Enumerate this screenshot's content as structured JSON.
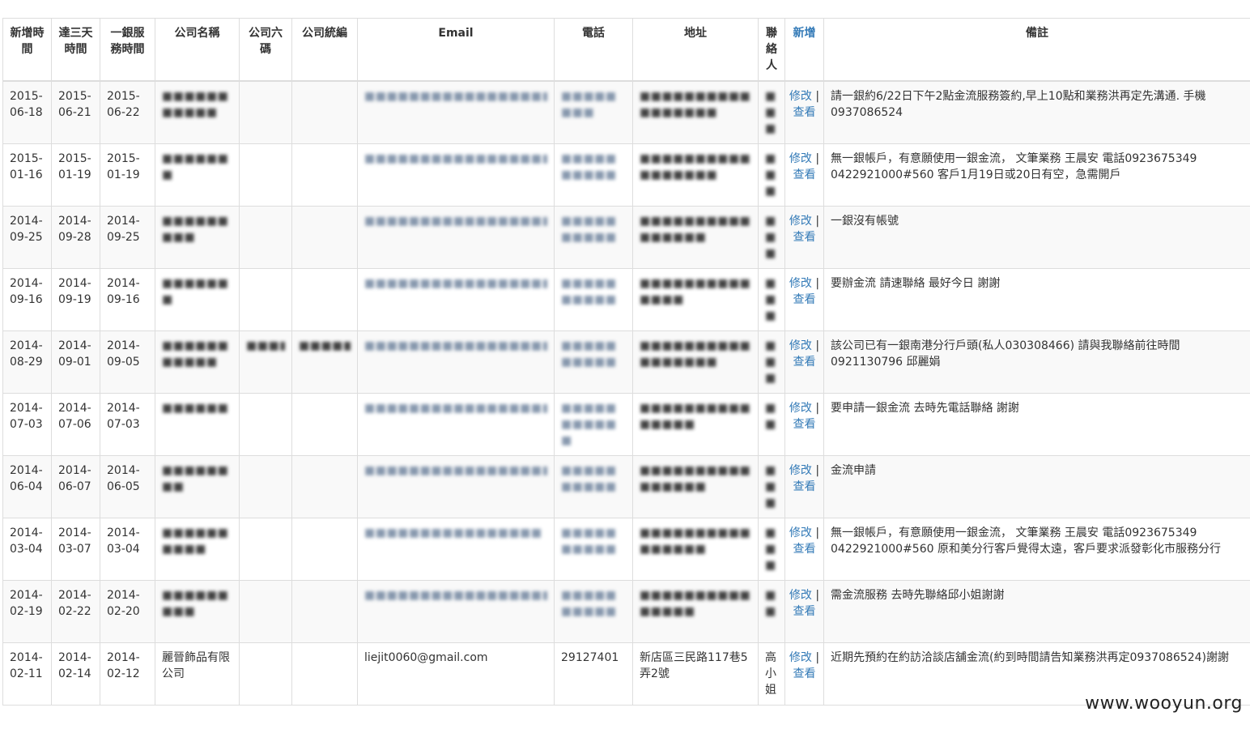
{
  "headers": {
    "created": "新增時間",
    "reach3days": "達三天時間",
    "bank_service": "一銀服務時間",
    "company_name": "公司名稱",
    "company_6code": "公司六碼",
    "tax_id": "公司統編",
    "email": "Email",
    "phone": "電話",
    "address": "地址",
    "contact": "聯絡人",
    "add_link": "新增",
    "notes": "備註"
  },
  "actions": {
    "edit": "修改",
    "sep": " | ",
    "view": "查看"
  },
  "rows": [
    {
      "created": "2015-06-18",
      "reach3": "2015-06-21",
      "service": "2015-06-22",
      "name": "■■■■■■■■■■■",
      "code6": "",
      "taxid": "",
      "email": "■■■■■■■■■■■■■■■■■■■■■■■■■■■",
      "phone": "■■■■■■■■",
      "address": "■■■■■■■■■■■■■■■■■",
      "contact": "■■■",
      "notes": "請一銀約6/22日下午2點金流服務簽約,早上10點和業務洪再定先溝通. 手機0937086524"
    },
    {
      "created": "2015-01-16",
      "reach3": "2015-01-19",
      "service": "2015-01-19",
      "name": "■■■■■■■",
      "code6": "",
      "taxid": "",
      "email": "■■■■■■■■■■■■■■■■■■■■",
      "phone": "■■■■■■■■■■",
      "address": "■■■■■■■■■■■■■■■■■",
      "contact": "■■■",
      "notes": "無一銀帳戶，有意願使用一銀金流， 文筆業務 王晨安 電話0923675349 0422921000#560 客戶1月19日或20日有空，急需開戶"
    },
    {
      "created": "2014-09-25",
      "reach3": "2014-09-28",
      "service": "2014-09-25",
      "name": "■■■■■■■■■",
      "code6": "",
      "taxid": "",
      "email": "■■■■■■■■■■■■■■■■■■",
      "phone": "■■■■■■■■■■",
      "address": "■■■■■■■■■■■■■■■■",
      "contact": "■■■",
      "notes": "一銀沒有帳號"
    },
    {
      "created": "2014-09-16",
      "reach3": "2014-09-19",
      "service": "2014-09-16",
      "name": "■■■■■■■",
      "code6": "",
      "taxid": "",
      "email": "■■■■■■■■■■■■■■■■■■",
      "phone": "■■■■■■■■■■",
      "address": "■■■■■■■■■■■■■■",
      "contact": "■■■",
      "notes": "要辦金流 請速聯絡 最好今日 謝謝"
    },
    {
      "created": "2014-08-29",
      "reach3": "2014-09-01",
      "service": "2014-09-05",
      "name": "■■■■■■■■■■■",
      "code6": "■■■■■■",
      "taxid": "■■■■■■■■",
      "email": "■■■■■■■■■■■■■■■■■■■■",
      "phone": "■■■■■■■■■■",
      "address": "■■■■■■■■■■■■■■■■■",
      "contact": "■■■",
      "notes": "該公司已有一銀南港分行戶頭(私人030308466) 請與我聯絡前往時間0921130796 邱麗娟"
    },
    {
      "created": "2014-07-03",
      "reach3": "2014-07-06",
      "service": "2014-07-03",
      "name": "■■■■■■",
      "code6": "",
      "taxid": "",
      "email": "■■■■■■■■■■■■■■■■■",
      "phone": "■■■■■■■■■■■",
      "address": "■■■■■■■■■■■■■■■",
      "contact": "■■",
      "notes": "要申請一銀金流 去時先電話聯絡 謝謝"
    },
    {
      "created": "2014-06-04",
      "reach3": "2014-06-07",
      "service": "2014-06-05",
      "name": "■■■■■■■■",
      "code6": "",
      "taxid": "",
      "email": "■■■■■■■■■■■■■■■■■■■■■■",
      "phone": "■■■■■■■■■■",
      "address": "■■■■■■■■■■■■■■■■",
      "contact": "■■■",
      "notes": "金流申請"
    },
    {
      "created": "2014-03-04",
      "reach3": "2014-03-07",
      "service": "2014-03-04",
      "name": "■■■■■■■■■■",
      "code6": "",
      "taxid": "",
      "email": "■■■■■■■■■■■■■■■■",
      "phone": "■■■■■■■■■■",
      "address": "■■■■■■■■■■■■■■■■",
      "contact": "■■■",
      "notes": "無一銀帳戶，有意願使用一銀金流， 文筆業務 王晨安 電話0923675349 0422921000#560 原和美分行客戶覺得太遠，客戶要求派發彰化市服務分行"
    },
    {
      "created": "2014-02-19",
      "reach3": "2014-02-22",
      "service": "2014-02-20",
      "name": "■■■■■■■■■",
      "code6": "",
      "taxid": "",
      "email": "■■■■■■■■■■■■■■■■■■",
      "phone": "■■■■■■■■■■",
      "address": "■■■■■■■■■■■■■■■",
      "contact": "■■",
      "notes": "需金流服務 去時先聯絡邱小姐謝謝"
    },
    {
      "created": "2014-02-11",
      "reach3": "2014-02-14",
      "service": "2014-02-12",
      "name": "麗晉飾品有限公司",
      "code6": "",
      "taxid": "",
      "email": "liejit0060@gmail.com",
      "phone": "29127401",
      "address": "新店區三民路117巷5弄2號",
      "contact": "高小姐",
      "notes": "近期先預約在約訪洽談店舖金流(約到時間請告知業務洪再定0937086524)謝謝"
    }
  ],
  "watermark": "www.wooyun.org",
  "colors": {
    "link": "#337ab7",
    "stripe": "#f9f9f9",
    "border": "#dddddd"
  }
}
